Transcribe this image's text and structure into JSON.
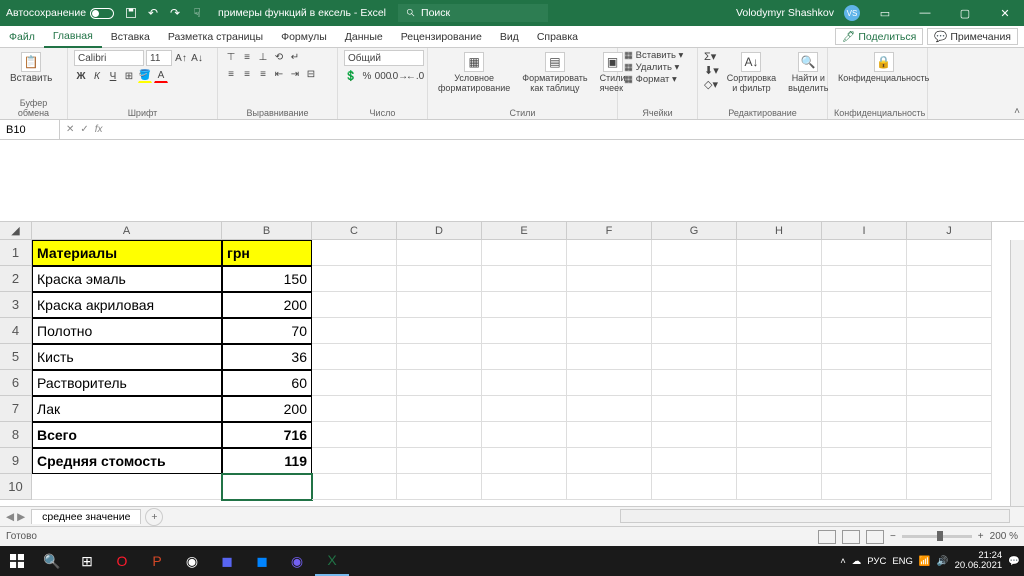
{
  "titlebar": {
    "autosave": "Автосохранение",
    "docname": "примеры функций в ексель - Excel",
    "search": "Поиск",
    "user": "Volodymyr Shashkov",
    "user_initials": "VS"
  },
  "menu": {
    "file": "Файл",
    "home": "Главная",
    "insert": "Вставка",
    "layout": "Разметка страницы",
    "formulas": "Формулы",
    "data": "Данные",
    "review": "Рецензирование",
    "view": "Вид",
    "help": "Справка",
    "share": "Поделиться",
    "comments": "Примечания"
  },
  "ribbon": {
    "clipboard_btn": "Вставить",
    "clipboard": "Буфер обмена",
    "font_name": "Calibri",
    "font_size": "11",
    "font": "Шрифт",
    "alignment": "Выравнивание",
    "number_fmt": "Общий",
    "number": "Число",
    "cond_fmt": "Условное форматирование",
    "as_table": "Форматировать как таблицу",
    "cell_styles": "Стили ячеек",
    "styles": "Стили",
    "insert_cells": "Вставить",
    "delete_cells": "Удалить",
    "format_cells": "Формат",
    "cells": "Ячейки",
    "sort_filter": "Сортировка и фильтр",
    "find_select": "Найти и выделить",
    "editing": "Редактирование",
    "confidential": "Конфиденциальность",
    "confidentiality": "Конфиденциальность"
  },
  "namebox": "B10",
  "cols": [
    "A",
    "B",
    "C",
    "D",
    "E",
    "F",
    "G",
    "H",
    "I",
    "J"
  ],
  "sheet": {
    "h1": "Материалы",
    "h2": "грн",
    "r2a": "Краска эмаль",
    "r2b": "150",
    "r3a": "Краска акриловая",
    "r3b": "200",
    "r4a": "Полотно",
    "r4b": "70",
    "r5a": "Кисть",
    "r5b": "36",
    "r6a": "Растворитель",
    "r6b": "60",
    "r7a": "Лак",
    "r7b": "200",
    "r8a": "Всего",
    "r8b": "716",
    "r9a": "Средняя стомость",
    "r9b": "119"
  },
  "tabs": {
    "sheet1": "среднее значение"
  },
  "status": {
    "ready": "Готово",
    "zoom": "200 %"
  },
  "taskbar": {
    "lang1": "РУС",
    "lang2": "ENG",
    "time": "21:24",
    "date": "20.06.2021"
  }
}
